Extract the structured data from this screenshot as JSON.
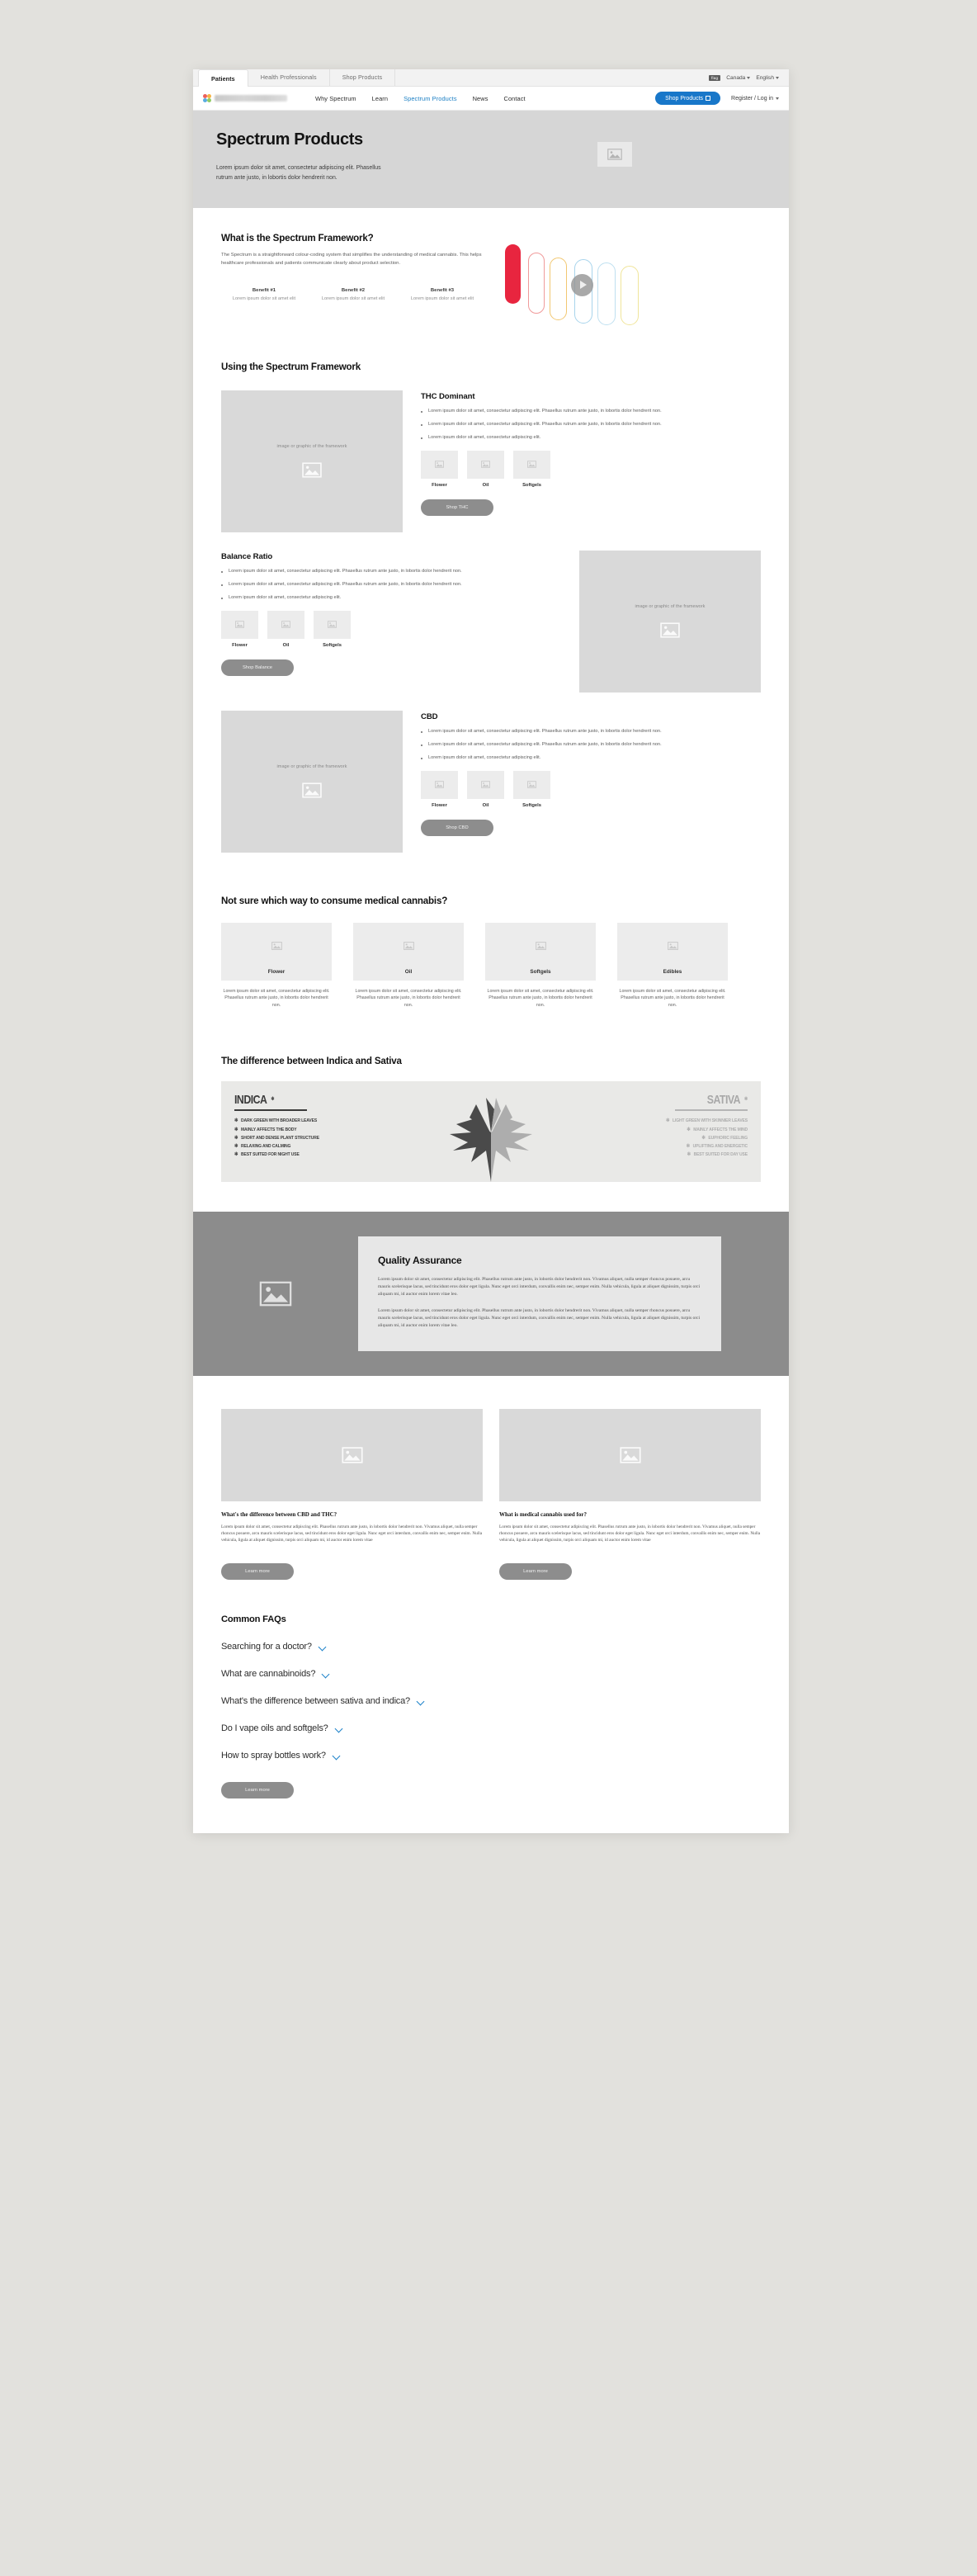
{
  "browser": {
    "audience_tabs": [
      {
        "label": "Patients",
        "active": true
      },
      {
        "label": "Health Professionals",
        "active": false
      },
      {
        "label": "Shop Products",
        "active": false
      }
    ],
    "locale": {
      "flag_chip": "flag",
      "country": "Canada",
      "language": "English"
    }
  },
  "nav": {
    "links": [
      {
        "label": "Why Spectrum",
        "active": false
      },
      {
        "label": "Learn",
        "active": false
      },
      {
        "label": "Spectrum Products",
        "active": true
      },
      {
        "label": "News",
        "active": false
      },
      {
        "label": "Contact",
        "active": false
      }
    ],
    "shop_button": "Shop Products",
    "account": "Register / Log in",
    "accent_color": "#1877c9"
  },
  "hero": {
    "title": "Spectrum Products",
    "body": "Lorem ipsum dolor sit amet, consectetur adipiscing elit. Phasellus rutrum ante justo, in lobortis dolor hendrerit non."
  },
  "framework": {
    "title": "What is the Spectrum Framework?",
    "body": "The Spectrum is a straightforward colour-coding system that simplifies the understanding of medical cannabis. This helps healthcare professionals and patients communicate clearly about product selection.",
    "benefits": [
      {
        "title": "Benefit #1",
        "text": "Lorem ipsum dolor sit amet elit"
      },
      {
        "title": "Benefit #2",
        "text": "Lorem ipsum dolor sit amet elit"
      },
      {
        "title": "Benefit #3",
        "text": "Lorem ipsum dolor sit amet elit"
      }
    ],
    "spectrum_colors": [
      "#e8253f",
      "#f07f7f",
      "#f4c04e",
      "#8fc8e8",
      "#f0e27a"
    ]
  },
  "using": {
    "title": "Using the Spectrum Framework",
    "image_caption": "image or graphic of the framework",
    "blocks": [
      {
        "title": "THC Dominant",
        "bullets": [
          "Lorem ipsum dolor sit amet, consectetur adipiscing elit. Phasellus rutrum ante justo, in lobortis dolor hendrerit non.",
          "Lorem ipsum dolor sit amet, consectetur adipiscing elit. Phasellus rutrum ante justo, in lobortis dolor hendrerit non.",
          "Lorem ipsum dolor sit amet, consectetur adipiscing elit."
        ],
        "cards": [
          "Flower",
          "Oil",
          "Softgels"
        ],
        "cta": "Shop THC"
      },
      {
        "title": "Balance Ratio",
        "bullets": [
          "Lorem ipsum dolor sit amet, consectetur adipiscing elit. Phasellus rutrum ante justo, in lobortis dolor hendrerit non.",
          "Lorem ipsum dolor sit amet, consectetur adipiscing elit. Phasellus rutrum ante justo, in lobortis dolor hendrerit non.",
          "Lorem ipsum dolor sit amet, consectetur adipiscing elit."
        ],
        "cards": [
          "Flower",
          "Oil",
          "Softgels"
        ],
        "cta": "Shop Balance"
      },
      {
        "title": "CBD",
        "bullets": [
          "Lorem ipsum dolor sit amet, consectetur adipiscing elit. Phasellus rutrum ante justo, in lobortis dolor hendrerit non.",
          "Lorem ipsum dolor sit amet, consectetur adipiscing elit. Phasellus rutrum ante justo, in lobortis dolor hendrerit non.",
          "Lorem ipsum dolor sit amet, consectetur adipiscing elit."
        ],
        "cards": [
          "Flower",
          "Oil",
          "Softgels"
        ],
        "cta": "Shop CBD"
      }
    ]
  },
  "consume": {
    "title": "Not sure which way to consume medical cannabis?",
    "items": [
      {
        "label": "Flower",
        "text": "Lorem ipsum dolor sit amet, consectetur adipiscing elit. Phasellus rutrum ante justo, in lobortis dolor hendrerit non."
      },
      {
        "label": "Oil",
        "text": "Lorem ipsum dolor sit amet, consectetur adipiscing elit. Phasellus rutrum ante justo, in lobortis dolor hendrerit non."
      },
      {
        "label": "Softgels",
        "text": "Lorem ipsum dolor sit amet, consectetur adipiscing elit. Phasellus rutrum ante justo, in lobortis dolor hendrerit non."
      },
      {
        "label": "Edibles",
        "text": "Lorem ipsum dolor sit amet, consectetur adipiscing elit. Phasellus rutrum ante justo, in lobortis dolor hendrerit non."
      }
    ]
  },
  "infographic": {
    "title": "The difference between Indica and Sativa",
    "indica": {
      "heading": "INDICA",
      "traits": [
        "DARK GREEN WITH BROADER LEAVES",
        "MAINLY AFFECTS THE BODY",
        "SHORT AND DENSE PLANT STRUCTURE",
        "RELAXING AND CALMING",
        "BEST SUITED FOR NIGHT USE"
      ]
    },
    "sativa": {
      "heading": "SATIVA",
      "traits": [
        "LIGHT GREEN WITH SKINNIER LEAVES",
        "MAINLY AFFECTS THE MIND",
        "EUPHORIC FEELING",
        "UPLIFTING AND ENERGETIC",
        "BEST SUITED FOR DAY USE"
      ]
    }
  },
  "quality": {
    "title": "Quality Assurance",
    "paragraph1": "Lorem ipsum dolor sit amet, consectetur adipiscing elit. Phasellus rutrum ante justo, in lobortis dolor hendrerit non. Vivamus aliquet, nulla semper rhoncus posuere, arcu mauris scelerisque lacus, sed tincidunt eros dolor eget ligula. Nunc eget orci interdum, convallis enim nec, semper enim. Nulla vehicula, ligula at aliquet dignissim, turpis orci aliquam mi, id auctor enim lorem vitae leo.",
    "paragraph2": "Lorem ipsum dolor sit amet, consectetur adipiscing elit. Phasellus rutrum ante justo, in lobortis dolor hendrerit non. Vivamus aliquet, nulla semper rhoncus posuere, arcu mauris scelerisque lacus, sed tincidunt eros dolor eget ligula. Nunc eget orci interdum, convallis enim nec, semper enim. Nulla vehicula, ligula at aliquet dignissim, turpis orci aliquam mi, id auctor enim lorem vitae leo."
  },
  "articles": [
    {
      "title": "What's the difference between CBD and THC?",
      "text": "Lorem ipsum dolor sit amet, consectetur adipiscing elit. Phasellus rutrum ante justo, in lobortis dolor hendrerit non. Vivamus aliquet, nulla semper rhoncus posuere, arcu mauris scelerisque lacus, sed tincidunt eros dolor eget ligula. Nunc eget orci interdum, convallis enim nec, semper enim. Nulla vehicula, ligula at aliquet dignissim, turpis orci aliquam mi, id auctor enim lorem vitae",
      "cta": "Learn more"
    },
    {
      "title": "What is medical cannabis used for?",
      "text": "Lorem ipsum dolor sit amet, consectetur adipiscing elit. Phasellus rutrum ante justo, in lobortis dolor hendrerit non. Vivamus aliquet, nulla semper rhoncus posuere, arcu mauris scelerisque lacus, sed tincidunt eros dolor eget ligula. Nunc eget orci interdum, convallis enim nec, semper enim. Nulla vehicula, ligula at aliquet dignissim, turpis orci aliquam mi, id auctor enim lorem vitae",
      "cta": "Learn more"
    }
  ],
  "faq": {
    "title": "Common FAQs",
    "questions": [
      "Searching for a doctor?",
      "What are cannabinoids?",
      "What's the difference between sativa and indica?",
      "Do I vape oils and softgels?",
      "How to spray bottles work?"
    ],
    "cta": "Learn more"
  }
}
